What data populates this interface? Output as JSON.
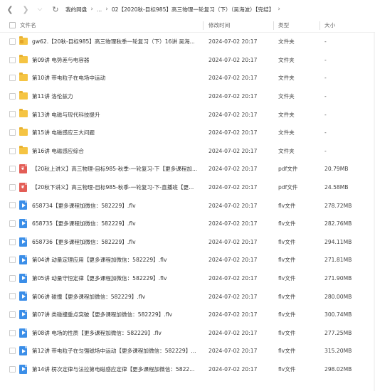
{
  "breadcrumb": {
    "items": [
      "我的网盘",
      "...",
      "02【2020秋-目标985】高三物理一轮复习（下）（吴海波）【完结】"
    ]
  },
  "columns": {
    "name": "文件名",
    "time": "修改时间",
    "type": "类型",
    "size": "大小"
  },
  "rows": [
    {
      "icon": "folder-icon",
      "kind": "folder-special",
      "name": "gw62.【20秋-目标985】高三物理秋季一轮复习（下）16讲 吴海...",
      "time": "2024-07-02 20:17",
      "type": "文件夹",
      "size": "-"
    },
    {
      "icon": "folder-icon",
      "kind": "folder",
      "name": "第09讲 电势差与电容器",
      "time": "2024-07-02 20:17",
      "type": "文件夹",
      "size": "-"
    },
    {
      "icon": "folder-icon",
      "kind": "folder",
      "name": "第10讲 带电粒子在电场中运动",
      "time": "2024-07-02 20:17",
      "type": "文件夹",
      "size": "-"
    },
    {
      "icon": "folder-icon",
      "kind": "folder",
      "name": "第11讲 洛伦兹力",
      "time": "2024-07-02 20:17",
      "type": "文件夹",
      "size": "-"
    },
    {
      "icon": "folder-icon",
      "kind": "folder",
      "name": "第13讲 电磁与现代科技提升",
      "time": "2024-07-02 20:17",
      "type": "文件夹",
      "size": "-"
    },
    {
      "icon": "folder-icon",
      "kind": "folder",
      "name": "第15讲 电磁感应三大问题",
      "time": "2024-07-02 20:17",
      "type": "文件夹",
      "size": "-"
    },
    {
      "icon": "folder-icon",
      "kind": "folder",
      "name": "第16讲 电磁感应综合",
      "time": "2024-07-02 20:17",
      "type": "文件夹",
      "size": "-"
    },
    {
      "icon": "pdf-icon",
      "kind": "pdf",
      "name": "【20秋上讲义】高三物理-目标985-秋季-一轮复习-下【更多课程加...",
      "time": "2024-07-02 20:17",
      "type": "pdf文件",
      "size": "20.79MB"
    },
    {
      "icon": "pdf-icon",
      "kind": "pdf",
      "name": "【20秋下讲义】高三物理-目标985-秋季-一轮复习-下-直播班【更...",
      "time": "2024-07-02 20:17",
      "type": "pdf文件",
      "size": "24.58MB"
    },
    {
      "icon": "video-icon",
      "kind": "video",
      "name": "658734【更多课程加微信：582229】.flv",
      "time": "2024-07-02 20:17",
      "type": "flv文件",
      "size": "278.72MB"
    },
    {
      "icon": "video-icon",
      "kind": "video",
      "name": "658735【更多课程加微信：582229】.flv",
      "time": "2024-07-02 20:17",
      "type": "flv文件",
      "size": "282.76MB"
    },
    {
      "icon": "video-icon",
      "kind": "video",
      "name": "658736【更多课程加微信：582229】.flv",
      "time": "2024-07-02 20:17",
      "type": "flv文件",
      "size": "294.11MB"
    },
    {
      "icon": "video-icon",
      "kind": "video",
      "name": "第04讲 动量定理应用【更多课程加微信：582229】.flv",
      "time": "2024-07-02 20:17",
      "type": "flv文件",
      "size": "271.81MB"
    },
    {
      "icon": "video-icon",
      "kind": "video",
      "name": "第05讲 动量守恒定律【更多课程加微信：582229】.flv",
      "time": "2024-07-02 20:17",
      "type": "flv文件",
      "size": "271.90MB"
    },
    {
      "icon": "video-icon",
      "kind": "video",
      "name": "第06讲 碰撞【更多课程加微信：582229】.flv",
      "time": "2024-07-02 20:17",
      "type": "flv文件",
      "size": "280.00MB"
    },
    {
      "icon": "video-icon",
      "kind": "video",
      "name": "第07讲 类碰撞重点突破【更多课程加微信：582229】.flv",
      "time": "2024-07-02 20:17",
      "type": "flv文件",
      "size": "300.74MB"
    },
    {
      "icon": "video-icon",
      "kind": "video",
      "name": "第08讲 电场的性质【更多课程加微信：582229】.flv",
      "time": "2024-07-02 20:17",
      "type": "flv文件",
      "size": "277.25MB"
    },
    {
      "icon": "video-icon",
      "kind": "video",
      "name": "第12讲 带电粒子在匀强磁场中运动【更多课程加微信：582229】...",
      "time": "2024-07-02 20:17",
      "type": "flv文件",
      "size": "315.20MB"
    },
    {
      "icon": "video-icon",
      "kind": "video",
      "name": "第14讲 楞次定律与法拉第电磁感应定律【更多课程加微信：5822...",
      "time": "2024-07-02 20:17",
      "type": "flv文件",
      "size": "298.02MB"
    }
  ]
}
